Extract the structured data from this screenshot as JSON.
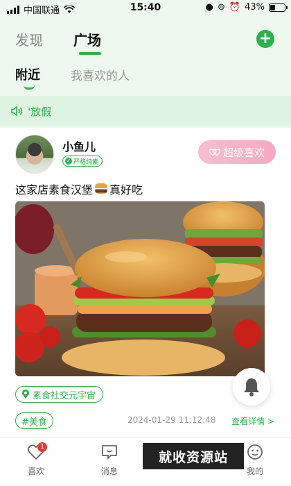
{
  "status_bar": {
    "carrier": "中国联通",
    "time": "15:40",
    "battery": "43%",
    "battery_level": 0.43
  },
  "top_tabs": [
    {
      "label": "发现",
      "active": false
    },
    {
      "label": "广场",
      "active": true
    }
  ],
  "sub_tabs": [
    {
      "label": "附近",
      "active": true
    },
    {
      "label": "我喜欢的人",
      "active": false
    }
  ],
  "notice": {
    "text": "'放假"
  },
  "post": {
    "username": "小鱼儿",
    "user_tag": "严格纯素",
    "super_like_label": "超级喜欢",
    "text_before": "这家店素食汉堡",
    "text_after": "真好吃",
    "location_tag": "素食社交元宇宙",
    "hashtag": "#美食",
    "timestamp": "2024-01-29 11:12:48",
    "detail_link": "查看详情 >"
  },
  "tab_bar": {
    "items": [
      {
        "label": "喜欢",
        "icon": "heart-icon",
        "badge": "1"
      },
      {
        "label": "消息",
        "icon": "message-icon"
      },
      {
        "label": "我的",
        "icon": "profile-icon"
      }
    ]
  },
  "watermark": "就收资源站",
  "colors": {
    "accent": "#2bb24c",
    "super_like": "#f5a9c2",
    "badge": "#e53935"
  }
}
